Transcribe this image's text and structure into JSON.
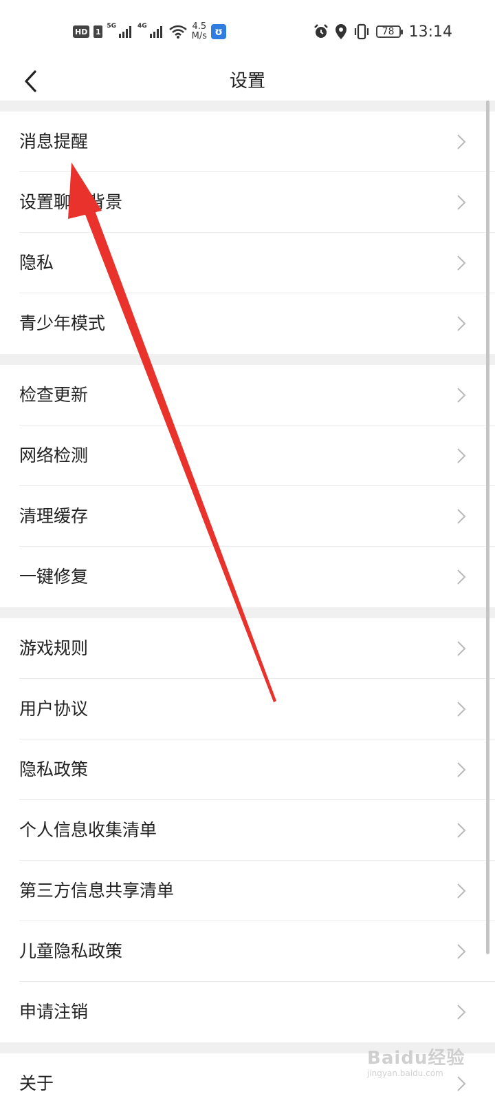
{
  "status_bar": {
    "hd": "HD",
    "sim": "1",
    "net1": "5G",
    "net2": "4G",
    "speed_value": "4.5",
    "speed_unit": "M/s",
    "battery": "78",
    "time": "13:14"
  },
  "nav": {
    "title": "设置",
    "back_icon": "chevron-left-icon"
  },
  "groups": [
    {
      "items": [
        "消息提醒",
        "设置聊天背景",
        "隐私",
        "青少年模式"
      ]
    },
    {
      "items": [
        "检查更新",
        "网络检测",
        "清理缓存",
        "一键修复"
      ]
    },
    {
      "items": [
        "游戏规则",
        "用户协议",
        "隐私政策",
        "个人信息收集清单",
        "第三方信息共享清单",
        "儿童隐私政策",
        "申请注销"
      ]
    },
    {
      "items": [
        "关于"
      ]
    }
  ],
  "watermark": {
    "logo": "Baidu经验",
    "url": "jingyan.baidu.com"
  },
  "colors": {
    "annotation_arrow": "#e8322b",
    "page_bg": "#f0f0f0"
  }
}
